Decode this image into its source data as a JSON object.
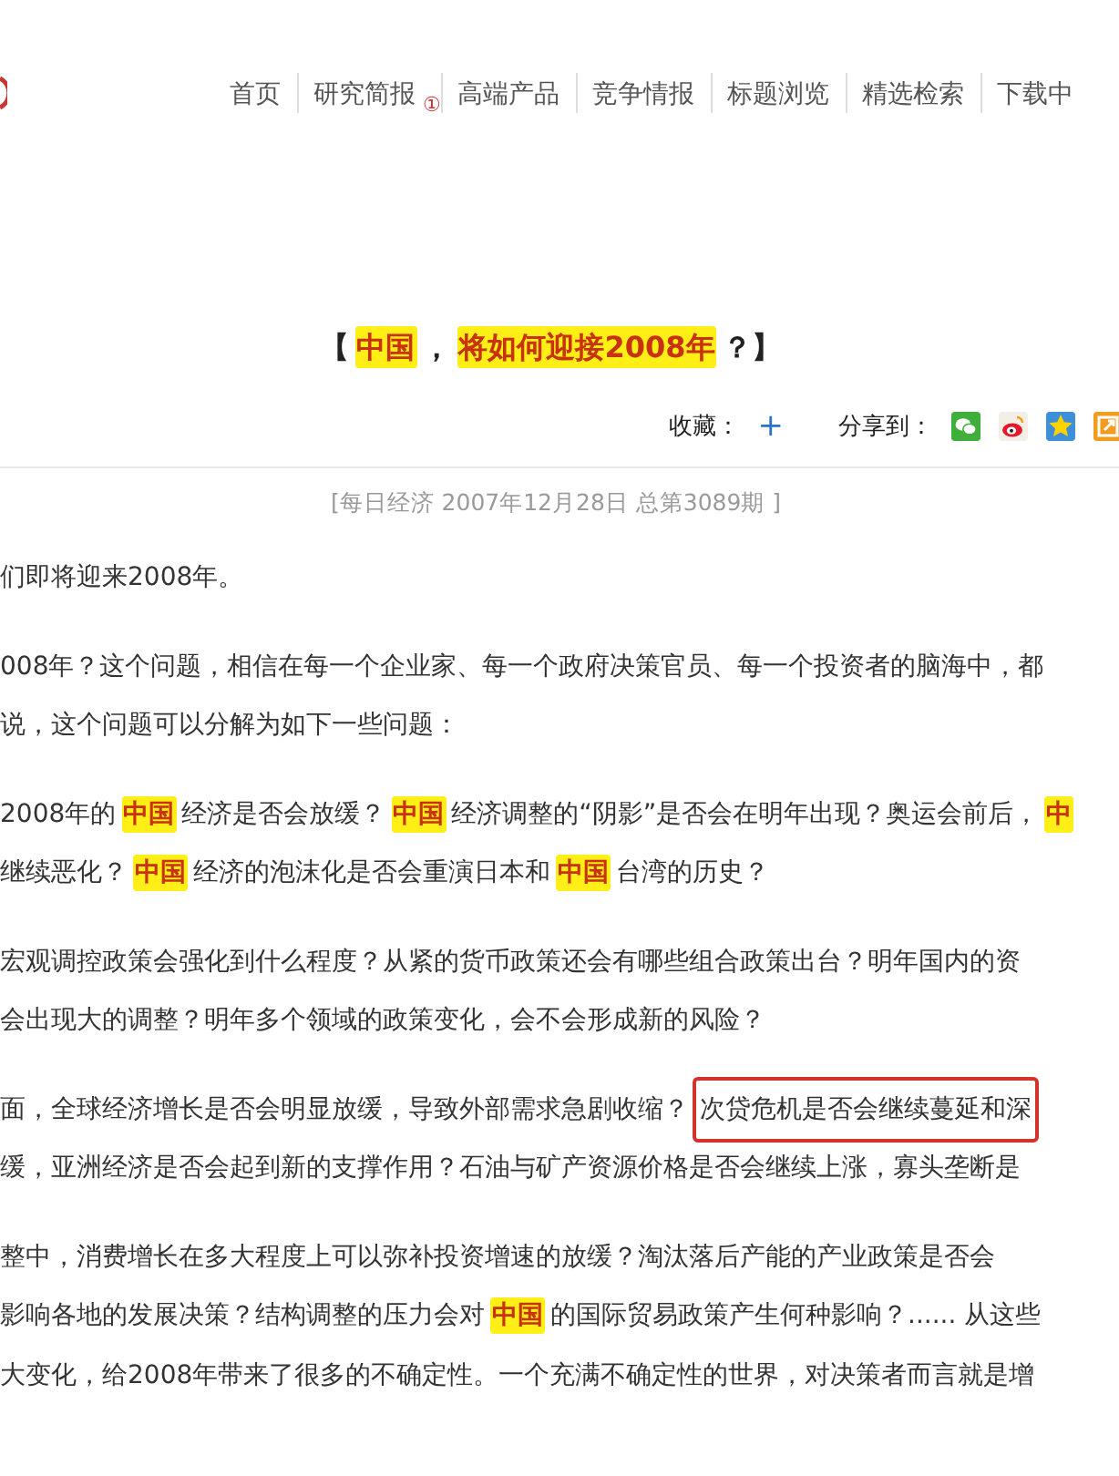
{
  "nav": [
    {
      "label": "首页"
    },
    {
      "label": "研究简报",
      "badge": "①"
    },
    {
      "label": "高端产品"
    },
    {
      "label": "竞争情报"
    },
    {
      "label": "标题浏览"
    },
    {
      "label": "精选检索"
    },
    {
      "label": "下载中"
    }
  ],
  "article": {
    "title": [
      {
        "text": "【",
        "kind": "plain"
      },
      {
        "text": "中国",
        "kind": "highlight"
      },
      {
        "text": "，",
        "kind": "plain"
      },
      {
        "text": "将如何迎接2008年",
        "kind": "highlight"
      },
      {
        "text": "？】",
        "kind": "plain"
      }
    ],
    "favorite_label": "收藏：",
    "favorite_action": "+",
    "share_label": "分享到：",
    "source": "[每日经济 2007年12月28日 总第3089期 ]",
    "paragraphs": [
      {
        "lines": [
          [
            {
              "text": "们即将迎来2008年。",
              "kind": "plain"
            }
          ]
        ]
      },
      {
        "lines": [
          [
            {
              "text": "008年？这个问题，相信在每一个企业家、每一个政府决策官员、每一个投资者的脑海中，都",
              "kind": "plain"
            }
          ],
          [
            {
              "text": "说，这个问题可以分解为如下一些问题：",
              "kind": "plain"
            }
          ]
        ]
      },
      {
        "lines": [
          [
            {
              "text": "2008年的",
              "kind": "plain"
            },
            {
              "text": "中国",
              "kind": "highlight"
            },
            {
              "text": "经济是否会放缓？",
              "kind": "plain"
            },
            {
              "text": "中国",
              "kind": "highlight"
            },
            {
              "text": "经济调整的“阴影”是否会在明年出现？奥运会前后，",
              "kind": "plain"
            },
            {
              "text": "中",
              "kind": "highlight"
            }
          ],
          [
            {
              "text": "继续恶化？",
              "kind": "plain"
            },
            {
              "text": "中国",
              "kind": "highlight"
            },
            {
              "text": "经济的泡沫化是否会重演日本和",
              "kind": "plain"
            },
            {
              "text": "中国",
              "kind": "highlight"
            },
            {
              "text": "台湾的历史？",
              "kind": "plain"
            }
          ]
        ]
      },
      {
        "lines": [
          [
            {
              "text": "宏观调控政策会强化到什么程度？从紧的货币政策还会有哪些组合政策出台？明年国内的资",
              "kind": "plain"
            }
          ],
          [
            {
              "text": "会出现大的调整？明年多个领域的政策变化，会不会形成新的风险？",
              "kind": "plain"
            }
          ]
        ]
      },
      {
        "lines": [
          [
            {
              "text": "面，全球经济增长是否会明显放缓，导致外部需求急剧收缩？",
              "kind": "plain"
            },
            {
              "text": "次贷危机是否会继续蔓延和深",
              "kind": "boxed"
            }
          ],
          [
            {
              "text": "缓，亚洲经济是否会起到新的支撑作用？石油与矿产资源价格是否会继续上涨，寡头垄断是",
              "kind": "plain"
            }
          ]
        ]
      },
      {
        "lines": [
          [
            {
              "text": "整中，消费增长在多大程度上可以弥补投资增速的放缓？淘汰落后产能的产业政策是否会",
              "kind": "plain"
            }
          ],
          [
            {
              "text": "影响各地的发展决策？结构调整的压力会对",
              "kind": "plain"
            },
            {
              "text": "中国",
              "kind": "highlight"
            },
            {
              "text": "的国际贸易政策产生何种影响？...... 从这些",
              "kind": "plain"
            }
          ],
          [
            {
              "text": "大变化，给2008年带来了很多的不确定性。一个充满不确定性的世界，对决策者而言就是增",
              "kind": "plain"
            }
          ]
        ]
      }
    ]
  }
}
